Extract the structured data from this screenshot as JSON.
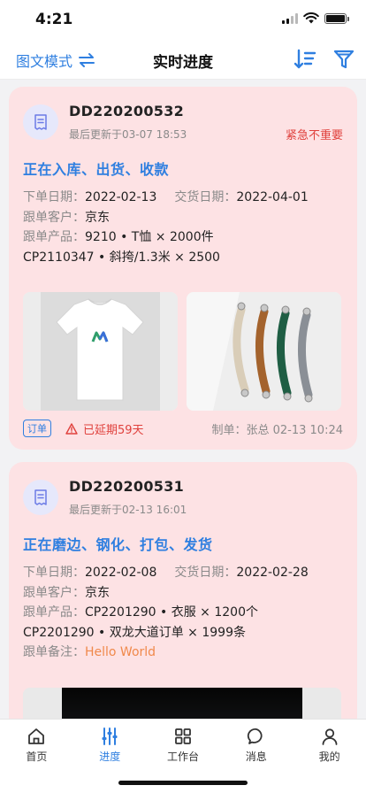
{
  "status_bar": {
    "time": "4:21"
  },
  "nav": {
    "mode_label": "图文模式",
    "title": "实时进度"
  },
  "orders": [
    {
      "order_no": "DD220200532",
      "updated": "最后更新于03-07 18:53",
      "priority": "紧急不重要",
      "progress": "正在入库、出货、收款",
      "order_date_label": "下单日期：",
      "order_date": "2022-02-13",
      "delivery_date_label": "交货日期：",
      "delivery_date": "2022-04-01",
      "customer_label": "跟单客户：",
      "customer": "京东",
      "product_label": "跟单产品：",
      "product_line1": "9210 • T恤 × 2000件",
      "product_line2": "CP2110347 • 斜挎/1.3米 × 2500",
      "tag": "订单",
      "overdue": "已延期59天",
      "maker": "制单：张总  02-13 10:24"
    },
    {
      "order_no": "DD220200531",
      "updated": "最后更新于02-13 16:01",
      "progress": "正在磨边、钢化、打包、发货",
      "order_date_label": "下单日期：",
      "order_date": "2022-02-08",
      "delivery_date_label": "交货日期：",
      "delivery_date": "2022-02-28",
      "customer_label": "跟单客户：",
      "customer": "京东",
      "product_label": "跟单产品：",
      "product_line1": "CP2201290 • 衣服 × 1200个",
      "product_line2": "CP2201290 • 双龙大道订单 × 1999条",
      "note_label": "跟单备注：",
      "note": "Hello World"
    }
  ],
  "tabs": [
    {
      "label": "首页",
      "icon": "home-icon"
    },
    {
      "label": "进度",
      "icon": "sliders-icon"
    },
    {
      "label": "工作台",
      "icon": "grid-icon"
    },
    {
      "label": "消息",
      "icon": "message-icon"
    },
    {
      "label": "我的",
      "icon": "user-icon"
    }
  ],
  "colors": {
    "accent": "#2f7fe0",
    "card_bg": "#fde2e4",
    "urgent": "#e0413d",
    "note": "#f0894b"
  }
}
